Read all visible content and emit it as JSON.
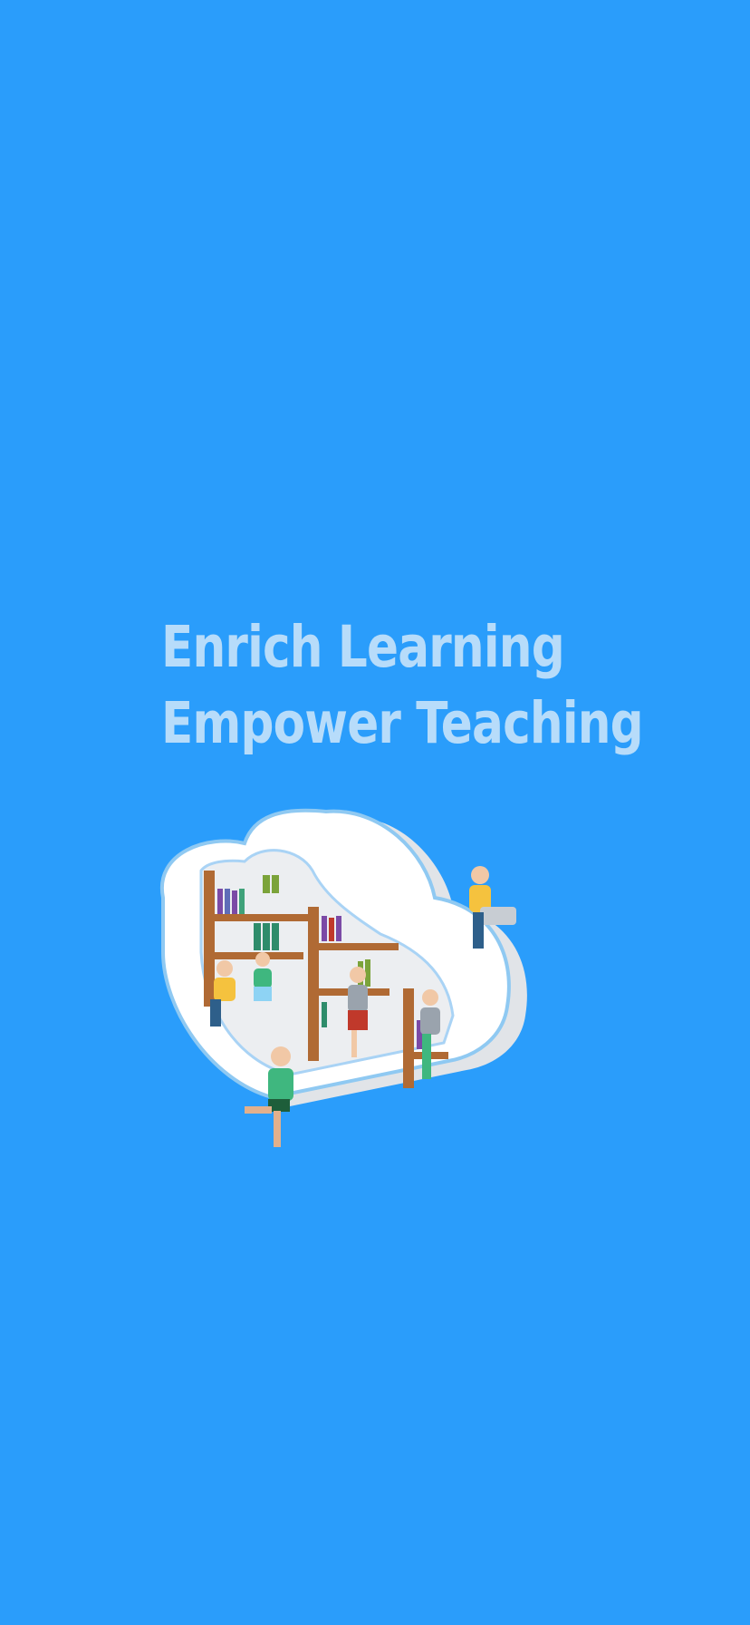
{
  "splash": {
    "tagline_line1": "Enrich Learning",
    "tagline_line2": "Empower Teaching",
    "illustration_icon": "cloud-library-illustration"
  },
  "colors": {
    "background": "#2A9DFB",
    "tagline": "#B7DCFA",
    "cloud": "#FFFFFF",
    "cloud_outline": "#8FC9F2",
    "shelf_wood": "#B06A34"
  }
}
